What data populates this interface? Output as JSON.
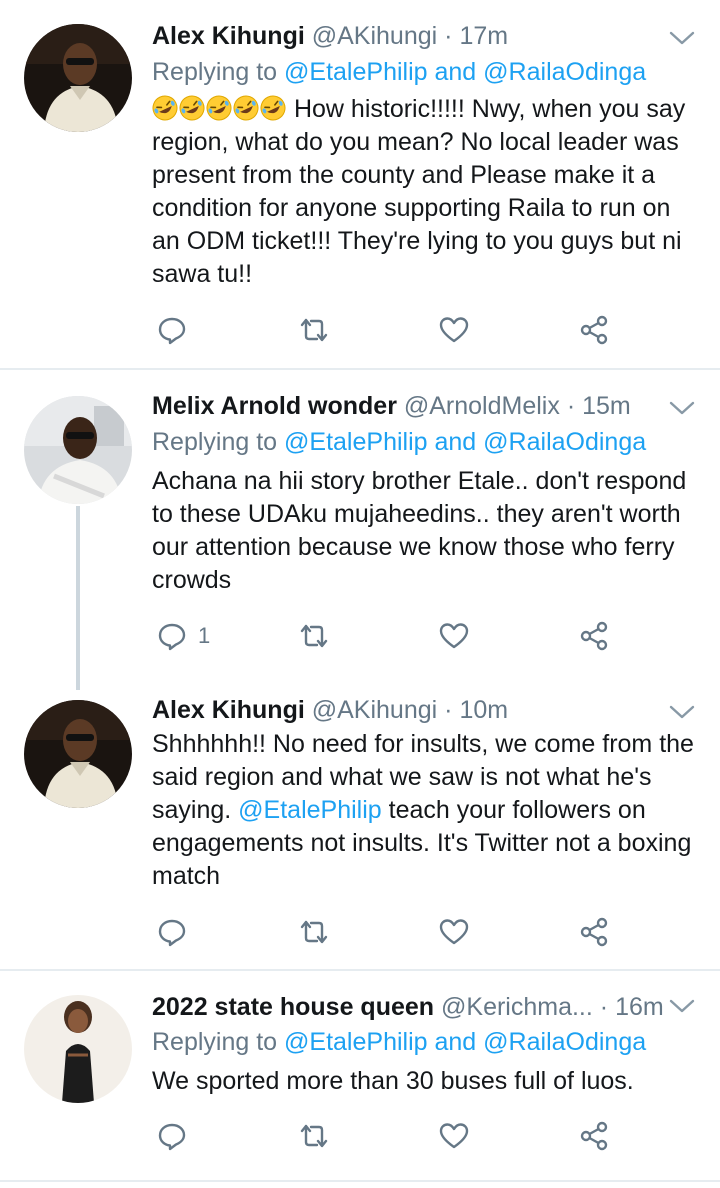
{
  "tweets": [
    {
      "name": "Alex Kihungi",
      "handle": "@AKihungi",
      "dot": "·",
      "time": "17m",
      "replying_prefix": "Replying to",
      "replying_to_1": "@EtalePhilip",
      "replying_and": "and",
      "replying_to_2": "@RailaOdinga",
      "emoji_icon": "rolling-on-floor-laughing-icon",
      "emoji_count": 5,
      "text": "How historic!!!!! Nwy, when you say region, what do you mean? No local leader was present from the county and Please make it a condition for anyone supporting Raila to run on an ODM ticket!!! They're lying to you guys but ni sawa tu!!",
      "reply_count": ""
    },
    {
      "name": "Melix Arnold wonder",
      "handle": "@ArnoldMelix",
      "dot": "·",
      "time": "15m",
      "replying_prefix": "Replying to",
      "replying_to_1": "@EtalePhilip",
      "replying_and": "and",
      "replying_to_2": "@RailaOdinga",
      "text": "Achana na hii story brother Etale.. don't respond to these UDAku mujaheedins.. they aren't worth our attention because we know those who ferry crowds",
      "reply_count": "1"
    },
    {
      "name": "Alex Kihungi",
      "handle": "@AKihungi",
      "dot": "·",
      "time": "10m",
      "text_before": "Shhhhhh!! No need for insults, we come from the said region and what we saw is not what he's saying.",
      "mention": "@EtalePhilip",
      "text_after": "teach your followers on engagements not insults. It's Twitter not a boxing match",
      "reply_count": ""
    },
    {
      "name": "2022 state house queen",
      "handle": "@Kerichma...",
      "dot": "·",
      "time": "16m",
      "replying_prefix": "Replying to",
      "replying_to_1": "@EtalePhilip",
      "replying_and": "and",
      "replying_to_2": "@RailaOdinga",
      "text": "We sported more than 30 buses full of luos.",
      "reply_count": ""
    }
  ],
  "icons": {
    "reply": "reply-icon",
    "retweet": "retweet-icon",
    "like": "heart-icon",
    "share": "share-icon",
    "more": "chevron-down-icon"
  },
  "colors": {
    "link": "#1da1f2",
    "muted": "#657786",
    "text": "#14171a",
    "divider": "#e6ecf0",
    "thread_line": "#ccd6dd"
  }
}
